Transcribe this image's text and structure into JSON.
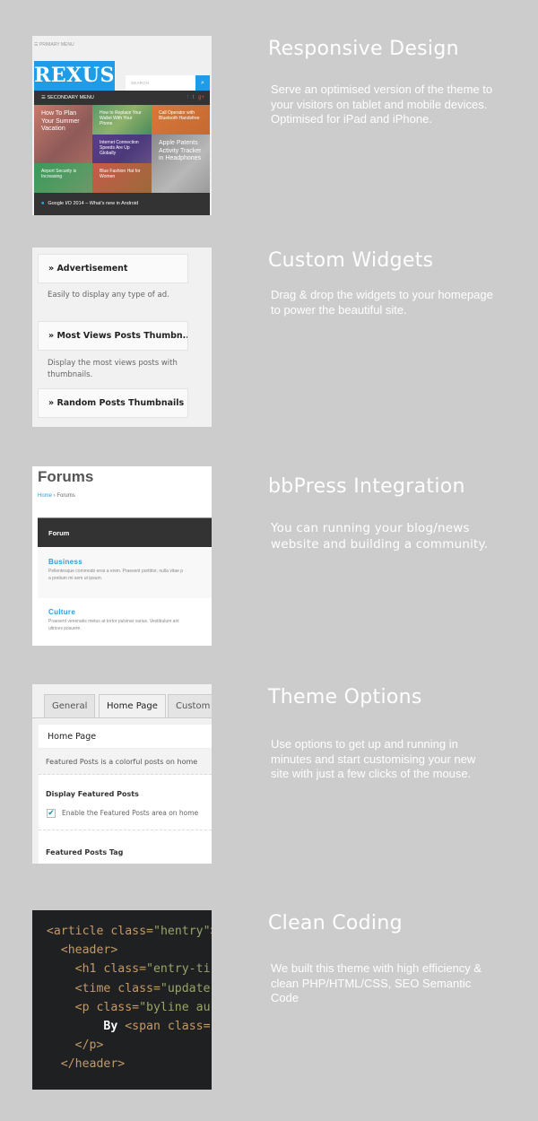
{
  "features": [
    {
      "title": "Responsive Design",
      "description": "Serve an optimised version of the theme to your visitors on tablet and mobile devices. Optimised for iPad and iPhone."
    },
    {
      "title": "Custom Widgets",
      "description": "Drag & drop the widgets to your homepage to power the beautiful site."
    },
    {
      "title": "bbPress Integration",
      "description": "You can running your blog/news website and building a community."
    },
    {
      "title": "Theme Options",
      "description": "Use options to get up and running in minutes and start customising your new site with just a few clicks of the mouse."
    },
    {
      "title": "Clean Coding",
      "description": "We built this theme with high efficiency & clean PHP/HTML/CSS, SEO Semantic Code"
    }
  ],
  "responsive_preview": {
    "primary_menu": "☰ PRIMARY MENU",
    "logo": "REXUS",
    "search_placeholder": "SEARCH",
    "search_icon": "⌕",
    "secondary_menu": "☰ SECONDARY MENU",
    "social": [
      "f",
      "t",
      "g+"
    ],
    "tiles": [
      "How To Plan Your Summer Vacation",
      "How to Replace Your Wallet With Your Phone",
      "Call Operator with Bluetooth Handsfree",
      "Internet Connection Speeds Are Up Globally",
      "Apple Patents Activity Tracker in Headphones",
      "Airport Security is Increasing",
      "Blue Fashion Hat for Women"
    ],
    "ticker_icon": "■",
    "ticker": "Google I/O 2014 – What's new in Android",
    "colors": {
      "brand": "#1f9ce8",
      "bar": "#333333"
    }
  },
  "widgets_preview": {
    "items": [
      {
        "title": "» Advertisement",
        "description": "Easily to display any type of ad."
      },
      {
        "title": "» Most Views Posts Thumbn...",
        "description": "Display the most views posts with thumbnails."
      },
      {
        "title": "» Random Posts Thumbnails",
        "description": ""
      }
    ]
  },
  "forums_preview": {
    "title": "Forums",
    "breadcrumb_home": "Home",
    "breadcrumb_sep": " › ",
    "breadcrumb_current": "Forums",
    "table_header": "Forum",
    "forums": [
      {
        "name": "Business",
        "description": "Pellentesque commodo eros a enim. Praesent porttitor, nulla vitae p",
        "description2": "a pretium mi sem ut ipsum."
      },
      {
        "name": "Culture",
        "description": "Praesent venenatis metus at tortor pulvinar varius. Vestibulum ant",
        "description2": "ultrices posuere."
      }
    ]
  },
  "options_preview": {
    "tabs": [
      "General",
      "Home Page",
      "Custom"
    ],
    "active_tab": "Home Page",
    "panel_title": "Home Page",
    "panel_description": "Featured Posts is a colorful posts on home",
    "display_label": "Display Featured Posts",
    "checkbox_checked": true,
    "checkbox_mark": "✔",
    "checkbox_label": "Enable the Featured Posts area on home",
    "tag_label": "Featured Posts Tag"
  },
  "code_preview": {
    "lines": [
      {
        "indent": "  ",
        "tag": "<article ",
        "attr": "class=",
        "str": "\"hentry\"",
        "rest": ">"
      },
      {
        "indent": "    ",
        "tag": "<header>",
        "attr": "",
        "str": "",
        "rest": ""
      },
      {
        "indent": "      ",
        "tag": "<h1 ",
        "attr": "class=",
        "str": "\"entry-ti",
        "rest": ""
      },
      {
        "indent": "      ",
        "tag": "<time ",
        "attr": "class=",
        "str": "\"update",
        "rest": ""
      },
      {
        "indent": "      ",
        "tag": "<p ",
        "attr": "class=",
        "str": "\"byline au",
        "rest": ""
      },
      {
        "indent": "          ",
        "text": "By",
        "tag": " <span ",
        "attr": "class=",
        "str": "",
        "rest": ""
      },
      {
        "indent": "      ",
        "tag": "</p>",
        "attr": "",
        "str": "",
        "rest": ""
      },
      {
        "indent": "    ",
        "tag": "</header>",
        "attr": "",
        "str": "",
        "rest": ""
      }
    ]
  }
}
